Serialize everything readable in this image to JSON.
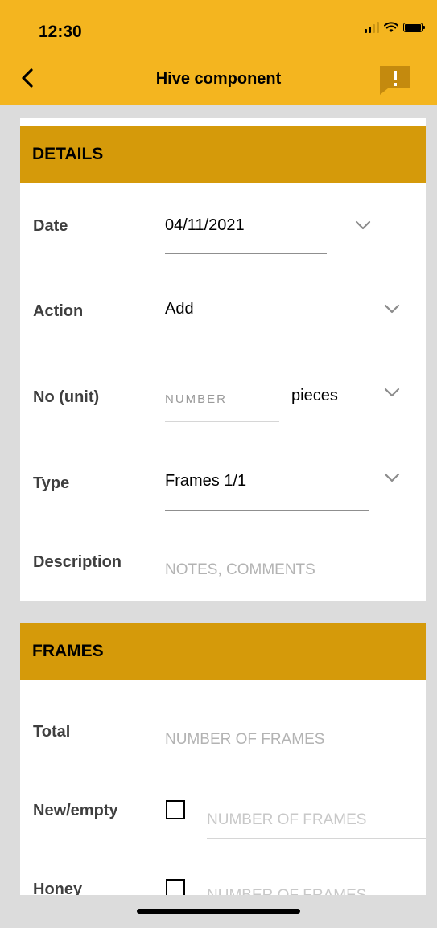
{
  "status_bar": {
    "time": "12:30"
  },
  "nav": {
    "title": "Hive component"
  },
  "details": {
    "header": "DETAILS",
    "date_label": "Date",
    "date_value": "04/11/2021",
    "action_label": "Action",
    "action_value": "Add",
    "unit_label": "No (unit)",
    "number_placeholder": "NUMBER",
    "unit_value": "pieces",
    "type_label": "Type",
    "type_value": "Frames 1/1",
    "description_label": "Description",
    "description_placeholder": "NOTES, COMMENTS"
  },
  "frames": {
    "header": "FRAMES",
    "total_label": "Total",
    "total_placeholder": "NUMBER OF FRAMES",
    "new_empty_label": "New/empty",
    "new_empty_placeholder": "NUMBER OF FRAMES",
    "honey_label": "Honey",
    "honey_placeholder": "NUMBER OF FRAMES"
  },
  "colors": {
    "topbar": "#f4b51f",
    "section_header": "#d59a0a",
    "background": "#dcdcdc"
  },
  "icons": {
    "back": "chevron-left-icon",
    "report": "report-bubble-icon",
    "dropdown": "chevron-down-icon"
  }
}
